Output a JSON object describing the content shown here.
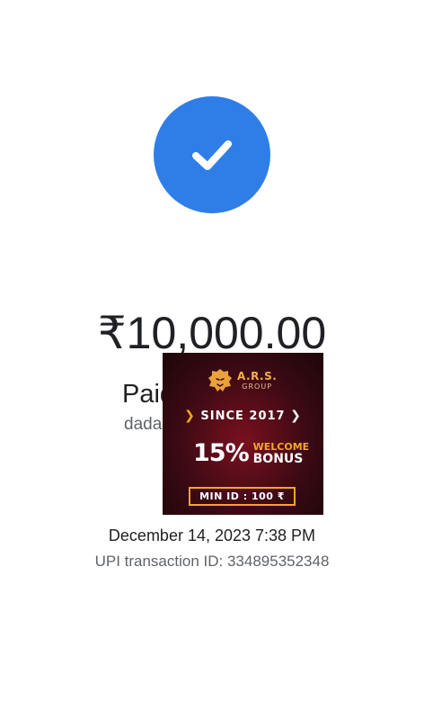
{
  "status_icon": "checkmark-icon",
  "colors": {
    "success_blue": "#2f7ee8",
    "text_primary": "#202124",
    "text_secondary": "#5f6368",
    "ad_accent": "#f5a623",
    "ad_background": "#3d0a14"
  },
  "payment": {
    "amount": "₹10,000.00",
    "paid_to_label": "Paid",
    "payee_partial": "dada",
    "datetime": "December 14, 2023 7:38 PM",
    "upi_txn": "UPI transaction ID: 334895352348"
  },
  "ad": {
    "logo_icon": "lion-icon",
    "brand": "A.R.S.",
    "brand_sub": "GROUP",
    "since": "SINCE 2017",
    "bonus_percent": "15%",
    "bonus_welcome": "WELCOME",
    "bonus_label": "BONUS",
    "min_id": "MIN ID : 100 ₹"
  }
}
